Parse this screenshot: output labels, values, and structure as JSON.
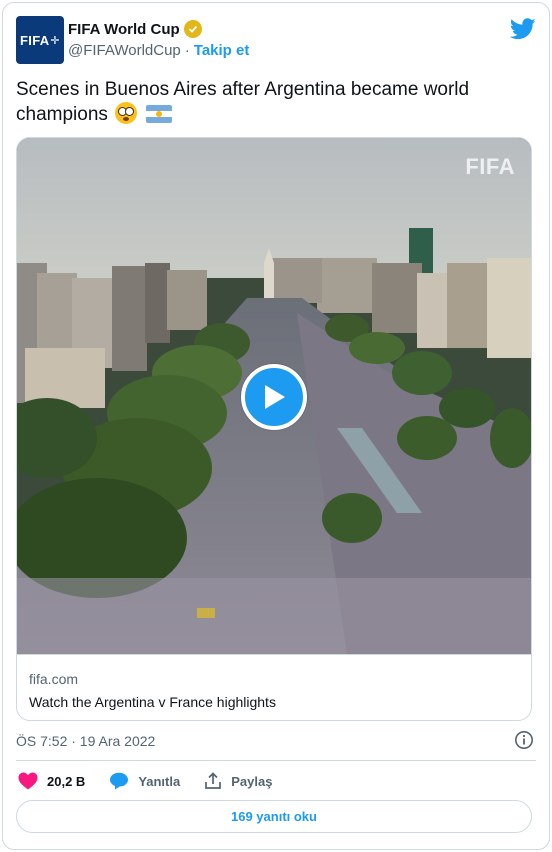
{
  "header": {
    "avatar_text": "FIFA",
    "display_name": "FIFA World Cup",
    "handle": "@FIFAWorldCup",
    "separator": "·",
    "follow_label": "Takip et"
  },
  "tweet": {
    "text": "Scenes in Buenos Aires after Argentina became world champions",
    "emojis": [
      "flushed-face",
      "argentina-flag"
    ]
  },
  "media": {
    "watermark": "FIFA",
    "play_label": "Play video",
    "link_domain": "fifa.com",
    "link_title": "Watch the Argentina v France highlights"
  },
  "meta": {
    "timestamp": "ÖS 7:52 · 19 Ara 2022"
  },
  "actions": {
    "like_count": "20,2 B",
    "reply_label": "Yanıtla",
    "share_label": "Paylaş"
  },
  "footer": {
    "read_replies_label": "169 yanıtı oku"
  },
  "colors": {
    "accent": "#1d9bf0",
    "like": "#f91880",
    "muted": "#536471",
    "verified": "#e2b719"
  }
}
